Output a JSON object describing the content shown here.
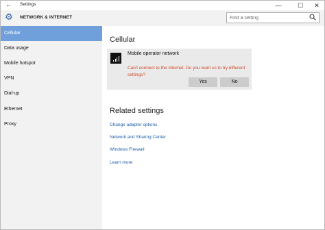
{
  "titlebar": {
    "back_glyph": "←",
    "title": "Settings",
    "minimize_glyph": "—",
    "maximize_glyph": "☐",
    "close_glyph": "✕"
  },
  "header": {
    "title": "NETWORK & INTERNET",
    "search_placeholder": "Find a setting"
  },
  "sidebar": {
    "items": [
      {
        "label": "Cellular",
        "active": true
      },
      {
        "label": "Data usage"
      },
      {
        "label": "Mobile hotspot"
      },
      {
        "label": "VPN"
      },
      {
        "label": "Dial-up"
      },
      {
        "label": "Ethernet"
      },
      {
        "label": "Proxy"
      }
    ]
  },
  "main": {
    "title": "Cellular",
    "card": {
      "title": "Mobile operator network",
      "message": "Can't connect to the Internet. Do you want us to try different settings?",
      "yes_label": "Yes",
      "no_label": "No"
    },
    "related_title": "Related settings",
    "links": [
      "Change adapter options",
      "Network and Sharing Center",
      "Windows Firewall",
      "Learn more"
    ]
  },
  "colors": {
    "accent": "#6fa0dc",
    "link": "#1a5dab",
    "error": "#d24726"
  },
  "icons": {
    "gear": "gear-icon",
    "search": "search-icon",
    "signal": "signal-icon"
  }
}
